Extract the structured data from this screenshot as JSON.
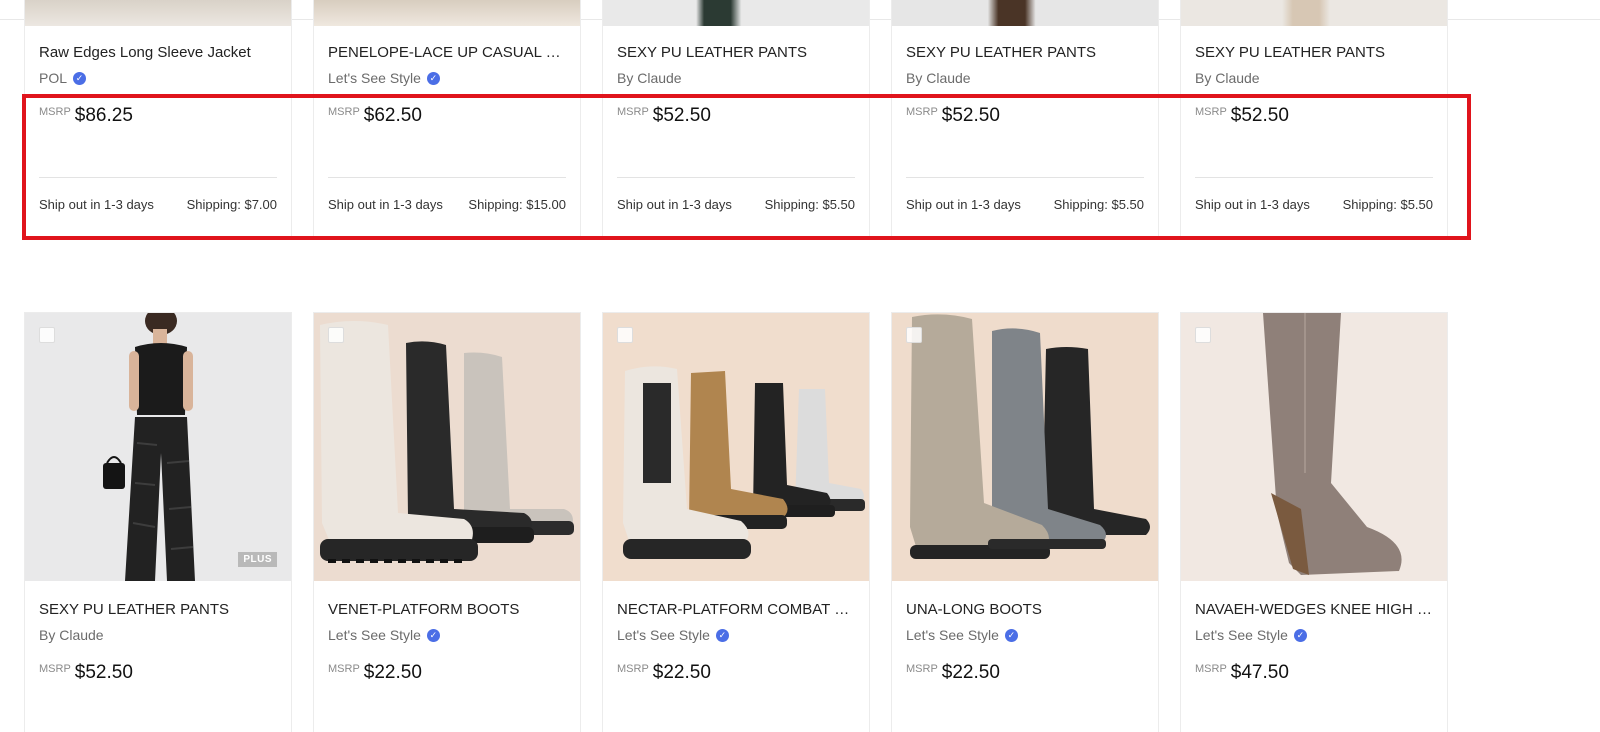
{
  "colors": {
    "highlight": "#e0141c",
    "verified": "#4b6ee6",
    "price": "#111111"
  },
  "row1": [
    {
      "title": "Raw Edges Long Sleeve Jacket",
      "brand": "POL",
      "verified": true,
      "msrp": "MSRP",
      "price": "$86.25",
      "ship_out": "Ship out in 1-3 days",
      "shipping": "Shipping: $7.00"
    },
    {
      "title": "PENELOPE-LACE UP CASUAL S...",
      "brand": "Let's See Style",
      "verified": true,
      "msrp": "MSRP",
      "price": "$62.50",
      "ship_out": "Ship out in 1-3 days",
      "shipping": "Shipping: $15.00"
    },
    {
      "title": "SEXY PU LEATHER PANTS",
      "brand": "By Claude",
      "verified": false,
      "msrp": "MSRP",
      "price": "$52.50",
      "ship_out": "Ship out in 1-3 days",
      "shipping": "Shipping: $5.50"
    },
    {
      "title": "SEXY PU LEATHER PANTS",
      "brand": "By Claude",
      "verified": false,
      "msrp": "MSRP",
      "price": "$52.50",
      "ship_out": "Ship out in 1-3 days",
      "shipping": "Shipping: $5.50"
    },
    {
      "title": "SEXY PU LEATHER PANTS",
      "brand": "By Claude",
      "verified": false,
      "msrp": "MSRP",
      "price": "$52.50",
      "ship_out": "Ship out in 1-3 days",
      "shipping": "Shipping: $5.50"
    }
  ],
  "row2": [
    {
      "title": "SEXY PU LEATHER PANTS",
      "brand": "By Claude",
      "verified": false,
      "msrp": "MSRP",
      "price": "$52.50",
      "badge": "PLUS",
      "image": "model-leather-pants"
    },
    {
      "title": "VENET-PLATFORM BOOTS",
      "brand": "Let's See Style",
      "verified": true,
      "msrp": "MSRP",
      "price": "$22.50",
      "image": "platform-boots"
    },
    {
      "title": "NECTAR-PLATFORM COMBAT B...",
      "brand": "Let's See Style",
      "verified": true,
      "msrp": "MSRP",
      "price": "$22.50",
      "image": "chelsea-boots"
    },
    {
      "title": "UNA-LONG BOOTS",
      "brand": "Let's See Style",
      "verified": true,
      "msrp": "MSRP",
      "price": "$22.50",
      "image": "long-boots"
    },
    {
      "title": "NAVAEH-WEDGES KNEE HIGH B...",
      "brand": "Let's See Style",
      "verified": true,
      "msrp": "MSRP",
      "price": "$47.50",
      "image": "wedge-knee-boot"
    }
  ]
}
